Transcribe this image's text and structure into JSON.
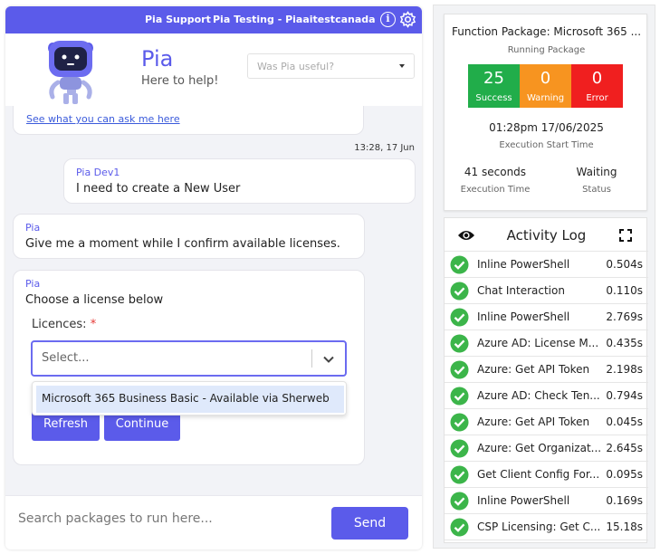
{
  "topbar": {
    "support": "Pia Support",
    "testing": "Pia Testing - Piaaitestcanada"
  },
  "header": {
    "title": "Pia",
    "subtitle": "Here to help!",
    "feedback_placeholder": "Was Pia useful?"
  },
  "messages": {
    "top_link": "See what you can ask me here",
    "timestamp": "13:28, 17 Jun",
    "user": {
      "sender": "Pia Dev1",
      "text": "I need to create a New User"
    },
    "bot1": {
      "sender": "Pia",
      "text": "Give me a moment while I confirm available licenses."
    },
    "bot2": {
      "sender": "Pia",
      "text": "Choose a license below",
      "field_label": "Licences:",
      "required_mark": "*",
      "select_placeholder": "Select...",
      "option": "Microsoft 365 Business Basic - Available via Sherweb",
      "refresh": "Refresh",
      "continue": "Continue"
    }
  },
  "input": {
    "placeholder": "Search packages to run here...",
    "send": "Send"
  },
  "package": {
    "title": "Function Package: Microsoft 365 ...",
    "subtitle": "Running Package",
    "stats": [
      {
        "value": "25",
        "label": "Success",
        "color": "#21ad4a"
      },
      {
        "value": "0",
        "label": "Warning",
        "color": "#f79420"
      },
      {
        "value": "0",
        "label": "Error",
        "color": "#f01f1f"
      }
    ],
    "start_time": "01:28pm 17/06/2025",
    "start_label": "Execution Start Time",
    "exec_time": "41 seconds",
    "exec_label": "Execution Time",
    "status": "Waiting",
    "status_label": "Status"
  },
  "activity_log": {
    "title": "Activity Log",
    "items": [
      {
        "name": "Inline PowerShell",
        "time": "0.504s"
      },
      {
        "name": "Chat Interaction",
        "time": "0.110s"
      },
      {
        "name": "Inline PowerShell",
        "time": "2.769s"
      },
      {
        "name": "Azure AD: License M...",
        "time": "0.435s"
      },
      {
        "name": "Azure: Get API Token",
        "time": "2.198s"
      },
      {
        "name": "Azure AD: Check Ten...",
        "time": "0.794s"
      },
      {
        "name": "Azure: Get API Token",
        "time": "0.045s"
      },
      {
        "name": "Azure: Get Organizat...",
        "time": "2.645s"
      },
      {
        "name": "Get Client Config For...",
        "time": "0.095s"
      },
      {
        "name": "Inline PowerShell",
        "time": "0.169s"
      },
      {
        "name": "CSP Licensing: Get C...",
        "time": "15.18s"
      }
    ]
  },
  "colors": {
    "accent": "#5b5bea",
    "success": "#21ad4a",
    "warning": "#f79420",
    "error": "#f01f1f"
  }
}
